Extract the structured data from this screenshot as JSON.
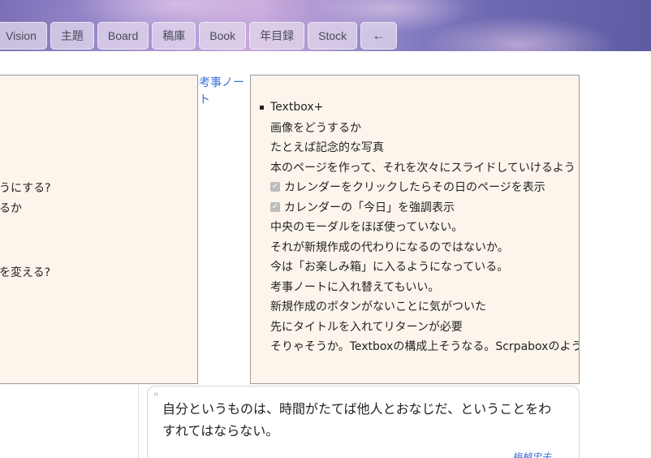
{
  "nav": {
    "items": [
      "Vision",
      "主題",
      "Board",
      "稿庫",
      "Book",
      "年目録",
      "Stock"
    ],
    "back_label": "←"
  },
  "left_panel": {
    "lines": [
      "うにする?",
      "るか",
      "を変える?"
    ]
  },
  "side_link": {
    "label": "考事ノート"
  },
  "note": {
    "title": "Textbox+",
    "lines": [
      "画像をどうするか",
      "たとえば記念的な写真",
      "本のページを作って、それを次々にスライドしていけるよう"
    ],
    "checked_items": [
      "カレンダーをクリックしたらその日のページを表示",
      "カレンダーの「今日」を強調表示"
    ],
    "more_lines": [
      "中央のモーダルをほぼ使っていない。",
      "それが新規作成の代わりになるのではないか。",
      "今は「お楽しみ箱」に入るようになっている。",
      "考事ノートに入れ替えてもいい。",
      "新規作成のボタンがないことに気がついた",
      "先にタイトルを入れてリターンが必要",
      "そりゃそうか。Textboxの構成上そうなる。Scrpaboxのよう"
    ]
  },
  "quote": {
    "mark": "\"",
    "text": "自分というものは、時間がたてば他人とおなじだ、ということをわすれてはならない。",
    "author": "梅棹忠夫"
  },
  "colors": {
    "panel_bg": "#fdf5ec",
    "link": "#3a6fd8",
    "nav_bg": "#e2d6ec"
  }
}
